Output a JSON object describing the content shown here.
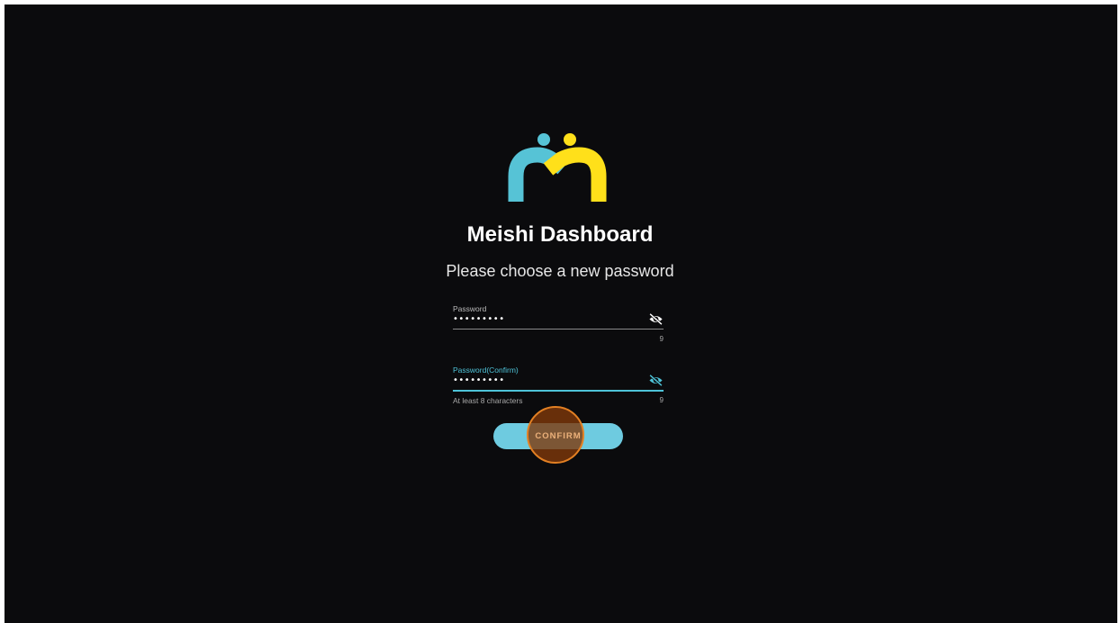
{
  "app": {
    "title": "Meishi Dashboard",
    "subtitle": "Please choose a new password"
  },
  "logo": {
    "icon": "meishi-logo",
    "colors": {
      "left": "#56c3d6",
      "right": "#ffe01a"
    }
  },
  "form": {
    "password": {
      "label": "Password",
      "value": "•••••••••",
      "counter": "9",
      "icon": "eye-off-icon"
    },
    "password_confirm": {
      "label": "Password(Confirm)",
      "value": "•••••••••",
      "counter": "9",
      "helper": "At least 8 characters",
      "icon": "eye-off-icon",
      "focused": true
    },
    "confirm_button": {
      "label": "CONFIRM"
    }
  },
  "colors": {
    "background": "#0b0b0d",
    "accent": "#4ec3d8",
    "button": "#6ecbe0",
    "click_indicator": "#e38023"
  }
}
